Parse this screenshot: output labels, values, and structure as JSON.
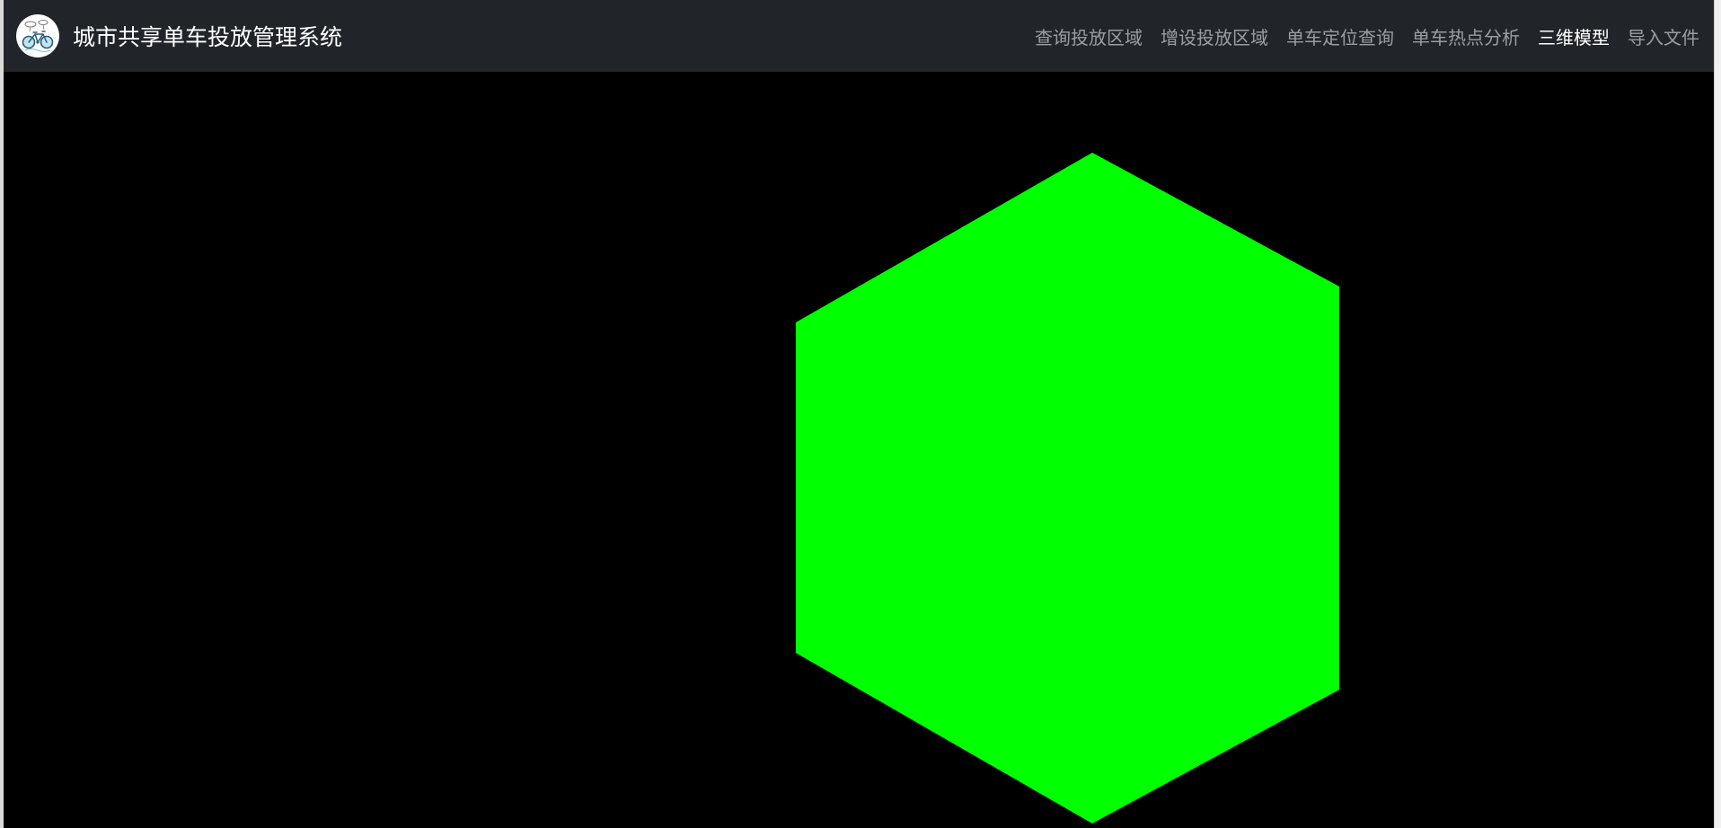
{
  "app": {
    "title": "城市共享单车投放管理系统",
    "logo_icon": "bicycle-icon"
  },
  "nav": {
    "items": [
      {
        "label": "查询投放区域",
        "active": false
      },
      {
        "label": "增设投放区域",
        "active": false
      },
      {
        "label": "单车定位查询",
        "active": false
      },
      {
        "label": "单车热点分析",
        "active": false
      },
      {
        "label": "三维模型",
        "active": true
      },
      {
        "label": "导入文件",
        "active": false
      }
    ]
  },
  "scene": {
    "background_color": "#000000",
    "model_shape": "cube",
    "model_color": "#00ff00"
  },
  "colors": {
    "navbar_bg": "#212529",
    "nav_active": "#ffffff",
    "nav_inactive": "rgba(255,255,255,0.55)"
  }
}
